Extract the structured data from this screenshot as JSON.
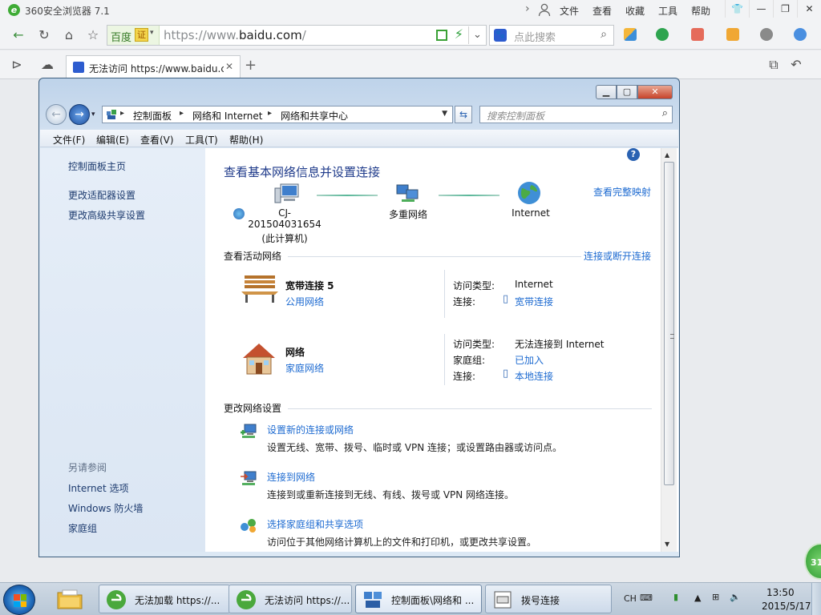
{
  "browser": {
    "app_name": "360安全浏览器 7.1",
    "menus": [
      "文件",
      "查看",
      "收藏",
      "工具",
      "帮助"
    ],
    "url_prefix": "https://www.",
    "url_domain": "baidu.com",
    "url_suffix": "/",
    "site_name": "百度",
    "cert_label": "证",
    "search_placeholder": "点此搜索",
    "tab_title": "无法访问 https://www.baidu.com",
    "win_buttons": {
      "minimize": "—",
      "maximize": "❐",
      "close": "✕"
    }
  },
  "window": {
    "breadcrumbs": [
      "控制面板",
      "网络和 Internet",
      "网络和共享中心"
    ],
    "search_placeholder": "搜索控制面板",
    "menubar": [
      "文件(F)",
      "编辑(E)",
      "查看(V)",
      "工具(T)",
      "帮助(H)"
    ],
    "left_nav": {
      "home": "控制面板主页",
      "links": [
        "更改适配器设置",
        "更改高级共享设置"
      ],
      "see_also_title": "另请参阅",
      "see_also": [
        "Internet 选项",
        "Windows 防火墙",
        "家庭组"
      ]
    },
    "main": {
      "heading": "查看基本网络信息并设置连接",
      "full_map": "查看完整映射",
      "nodes": [
        {
          "label": "CJ-201504031654",
          "sub": "(此计算机)"
        },
        {
          "label": "多重网络",
          "sub": ""
        },
        {
          "label": "Internet",
          "sub": ""
        }
      ],
      "active_title": "查看活动网络",
      "connect_link": "连接或断开连接",
      "networks": [
        {
          "name": "宽带连接  5",
          "type": "公用网络",
          "rows": [
            {
              "key": "访问类型:",
              "value": "Internet",
              "link": false
            },
            {
              "key": "连接:",
              "value": "宽带连接",
              "link": true
            }
          ]
        },
        {
          "name": "网络",
          "type": "家庭网络",
          "rows": [
            {
              "key": "访问类型:",
              "value": "无法连接到 Internet",
              "link": false
            },
            {
              "key": "家庭组:",
              "value": "已加入",
              "link": true
            },
            {
              "key": "连接:",
              "value": "本地连接",
              "link": true
            }
          ]
        }
      ],
      "change_title": "更改网络设置",
      "tasks": [
        {
          "link": "设置新的连接或网络",
          "desc": "设置无线、宽带、拨号、临时或 VPN 连接；或设置路由器或访问点。"
        },
        {
          "link": "连接到网络",
          "desc": "连接到或重新连接到无线、有线、拨号或 VPN 网络连接。"
        },
        {
          "link": "选择家庭组和共享选项",
          "desc": "访问位于其他网络计算机上的文件和打印机，或更改共享设置。"
        }
      ]
    }
  },
  "badge": "31",
  "taskbar": {
    "tasks": [
      "无法加载 https://...",
      "无法访问 https://...",
      "控制面板\\网络和 ...",
      "拨号连接"
    ],
    "ime": "CH",
    "time": "13:50",
    "date": "2015/5/17"
  }
}
